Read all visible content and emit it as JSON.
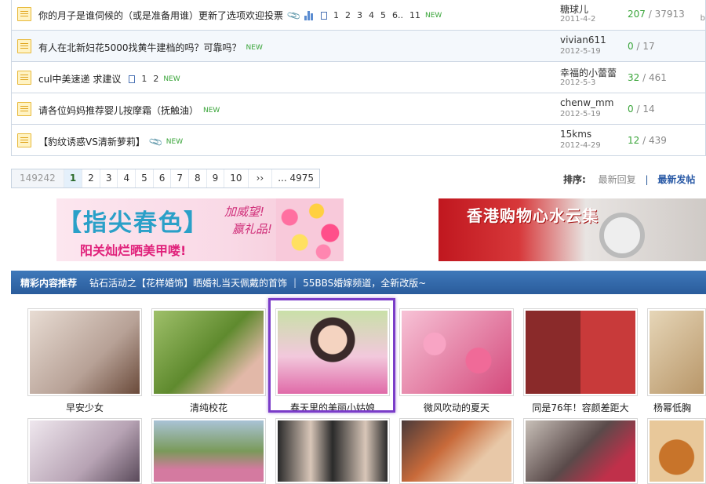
{
  "threads": [
    {
      "title": "你的月子是谁伺候的（或是准备用谁）更新了选项欢迎投票",
      "has_attachment": true,
      "has_poll": true,
      "pages": [
        "1",
        "2",
        "3",
        "4",
        "5",
        "6..",
        "11"
      ],
      "tag": "NEW",
      "author": "糖球儿",
      "date": "2011-4-2",
      "replies": "207",
      "views": "37913",
      "edge": "b"
    },
    {
      "title": "有人在北新妇花5000找黄牛建档的吗？可靠吗？",
      "tag": "NEW",
      "author": "vivian611",
      "date": "2012-5-19",
      "replies": "0",
      "views": "17"
    },
    {
      "title": "cul中美速递 求建议",
      "pages": [
        "1",
        "2"
      ],
      "tag": "NEW",
      "author": "幸福的小蕾蕾",
      "date": "2012-5-3",
      "replies": "32",
      "views": "461"
    },
    {
      "title": "请各位妈妈推荐婴儿按摩霜（抚触油）",
      "tag": "NEW",
      "author": "chenw_mm",
      "date": "2012-5-19",
      "replies": "0",
      "views": "14"
    },
    {
      "title": "【豹纹诱惑VS清新萝莉】",
      "has_attachment": true,
      "tag": "NEW",
      "author": "15kms",
      "date": "2012-4-29",
      "replies": "12",
      "views": "439"
    }
  ],
  "pagination": {
    "total": "149242",
    "pages": [
      "1",
      "2",
      "3",
      "4",
      "5",
      "6",
      "7",
      "8",
      "9",
      "10",
      "››",
      "... 4975"
    ],
    "current": "1"
  },
  "sort": {
    "label": "排序:",
    "options": [
      "最新回复",
      "最新发帖"
    ],
    "active": "最新发帖"
  },
  "banners": {
    "left": {
      "main": "【指尖春色】",
      "bonus_1": "加威望!",
      "bonus_2": "赢礼品!",
      "sub": "阳关灿烂晒美甲喽!"
    },
    "right": {
      "main": "香港购物心水云集"
    }
  },
  "featured": {
    "title": "精彩内容推荐",
    "links": [
      "钻石活动之【花样婚饰】晒婚礼当天佩戴的首饰",
      "55BBS婚嫁频道，全新改版~"
    ]
  },
  "gallery_row1": [
    {
      "caption": "早安少女",
      "color": "#d9c9c0"
    },
    {
      "caption": "清纯校花",
      "color": "#6f9a3c"
    },
    {
      "caption": "春天里的美丽小姑娘",
      "color": "#e9b6d0",
      "selected": true
    },
    {
      "caption": "微风吹动的夏天",
      "color": "#e57fa4"
    },
    {
      "caption": "同是76年！容颜差距大",
      "color": "#7a2a2a"
    },
    {
      "caption": "杨幂低胸",
      "color": "#c9b08a"
    }
  ],
  "gallery_row2": [
    {
      "color": "#c9b3c4"
    },
    {
      "color": "#4f7d96"
    },
    {
      "color": "#3a3a3a"
    },
    {
      "color": "#b88a60"
    },
    {
      "color": "#9a7c6a"
    },
    {
      "color": "#c07a2a"
    }
  ],
  "colors": {
    "accent": "#2a5c9c",
    "new_tag": "#3aa53a",
    "selection": "#7a3cc8"
  }
}
